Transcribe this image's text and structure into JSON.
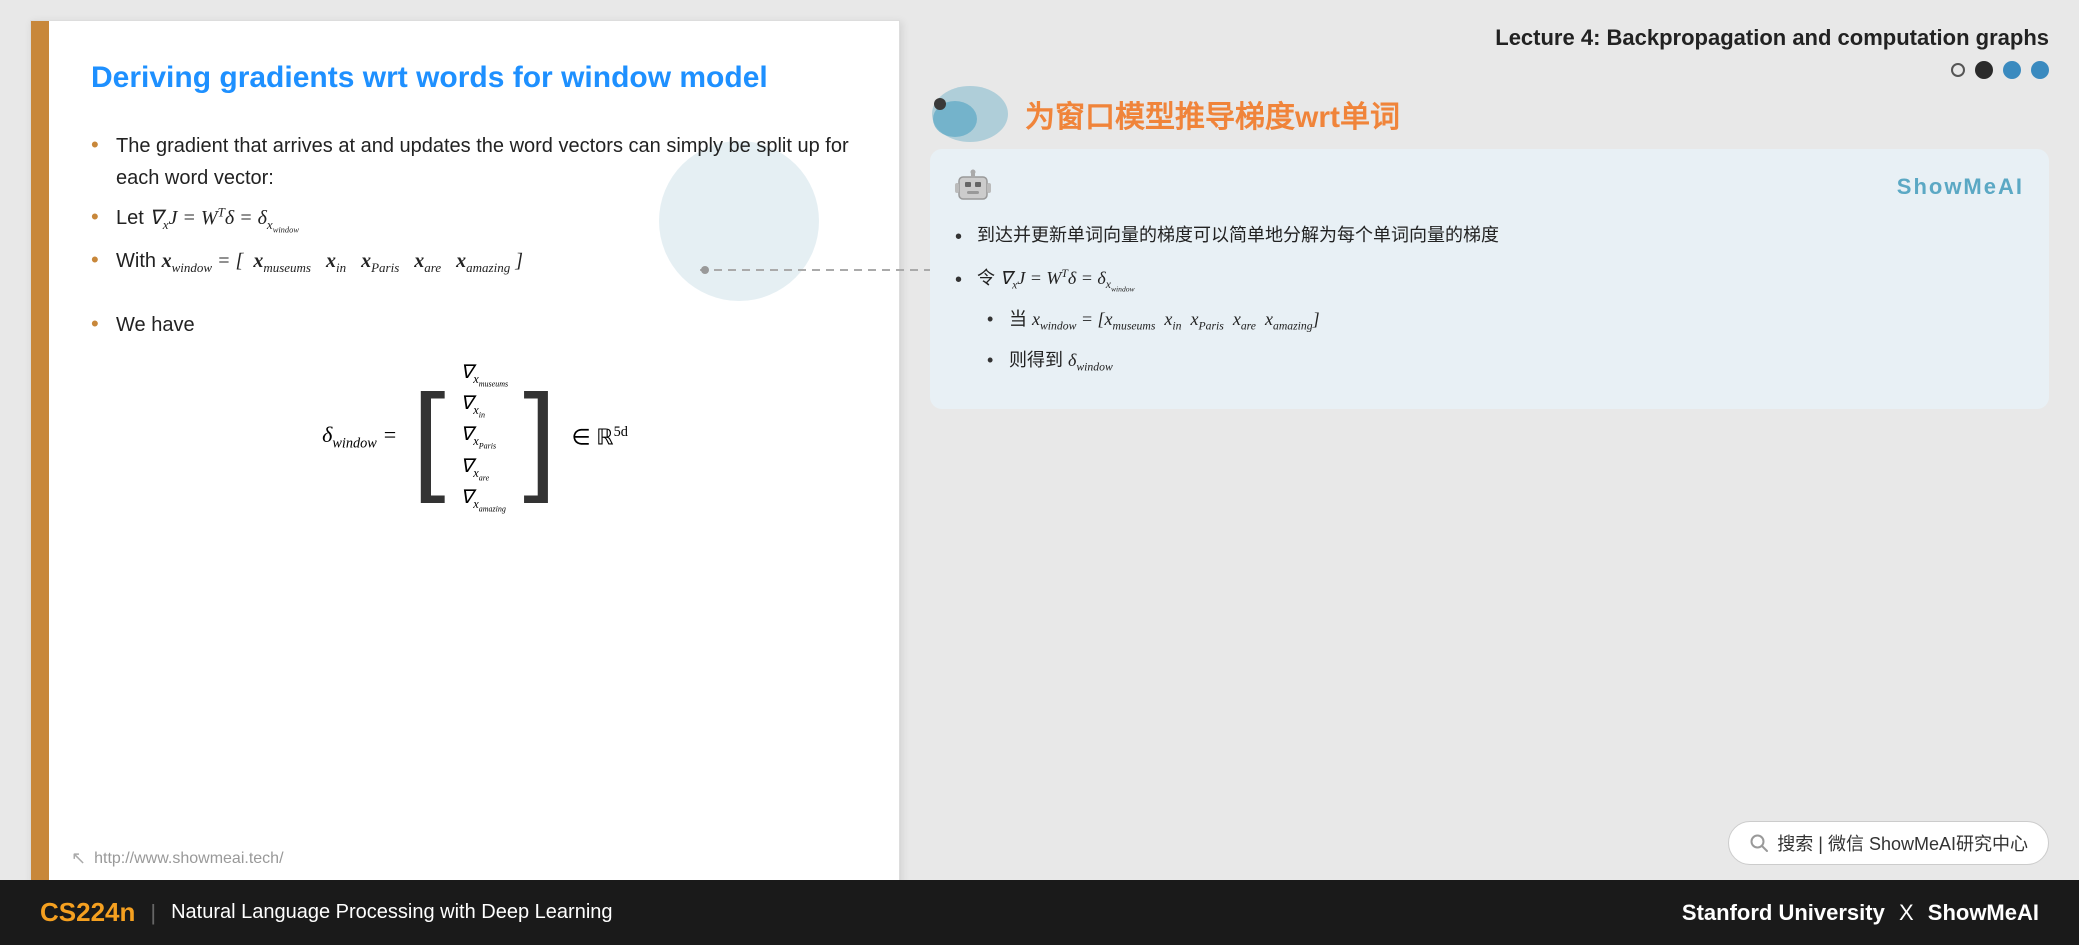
{
  "lecture": {
    "title": "Lecture 4:  Backpropagation and computation graphs"
  },
  "slide": {
    "title": "Deriving gradients wrt words for window model",
    "bullet1": "The gradient that arrives at and updates the word vectors can simply be split up for each word vector:",
    "bullet2_label": "Let",
    "bullet2_math": "∇ₓJ = Wᵀδ = δₓ_window",
    "bullet3_label": "With",
    "bullet3_math": "x_window = [ x_museums   x_in   x_Paris   x_are   x_amazing ]",
    "bullet4": "We have",
    "delta_eq": "δ_window =",
    "matrix_rows": [
      "∇ₓ_museums",
      "∇ₓ_in",
      "∇ₓ_Paris",
      "∇ₓ_are",
      "∇ₓ_amazing"
    ],
    "belongs": "∈ ℝ⁵ᵈ",
    "footer_url": "http://www.showmeai.tech/"
  },
  "chinese_panel": {
    "title": "为窗口模型推导梯度wrt单词",
    "card": {
      "brand": "ShowMeAI",
      "bullet1": "到达并更新单词向量的梯度可以简单地分解为每个单词向量的梯度",
      "bullet2_prefix": "令",
      "bullet2_math": "∇ₓJ = Wᵀδ = δₓ_window",
      "sub_bullet1_prefix": "当",
      "sub_bullet1": "x_window = [x_museums   x_in   x_Paris   x_are   x_amazing]",
      "sub_bullet2_prefix": "则得到",
      "sub_bullet2": "δ_window"
    }
  },
  "search": {
    "text": "搜索 | 微信  ShowMeAI研究中心"
  },
  "bottom_bar": {
    "course_code": "CS224n",
    "divider": "|",
    "course_name": "Natural Language Processing with Deep Learning",
    "stanford": "Stanford University",
    "x": "X",
    "showmeai": "ShowMeAI"
  },
  "dots": [
    {
      "filled": false
    },
    {
      "filled": true
    },
    {
      "filled": true
    },
    {
      "filled": true
    }
  ]
}
